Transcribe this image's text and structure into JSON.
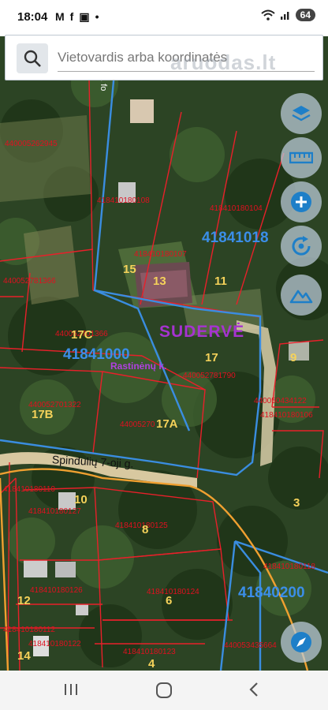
{
  "status_bar": {
    "time": "18:04",
    "left_icons": [
      "M",
      "f",
      "▣",
      "•"
    ],
    "battery": "64"
  },
  "search": {
    "placeholder": "Vietovardis arba koordinatės"
  },
  "watermark": "aruodas.lt",
  "map": {
    "road_label": "g. fo",
    "street_name": "Spindulių 7-oji g.",
    "village_name": "SUDERVĖ",
    "village_small": "Rastinėnų k.",
    "blue_ids": [
      "41841018",
      "41841000",
      "41840200"
    ],
    "parcel_ids": [
      "440005262945",
      "418410180108",
      "418410180104",
      "418410180107",
      "440052781366",
      "440052701366",
      "440052781790",
      "440052701322",
      "44005270",
      "440050434122",
      "418410180106",
      "418410180110",
      "418410180127",
      "418410180125",
      "418410180126",
      "418410180124",
      "418410180112",
      "418410180122",
      "418410180123",
      "418410180118",
      "440053435664"
    ],
    "plot_numbers": [
      "15",
      "13",
      "11",
      "17C",
      "17",
      "9",
      "17B",
      "17A",
      "10",
      "3",
      "8",
      "6",
      "12",
      "14",
      "4"
    ]
  },
  "colors": {
    "parcel_lines": "#e8202a",
    "cadastre_blue": "#3a8de0",
    "road_orange": "#f0a030",
    "plot_numbers": "#f5d25a",
    "village": "#a633d0"
  },
  "controls": [
    "layers-icon",
    "ruler-icon",
    "plus-icon",
    "locate-icon",
    "terrain-icon",
    "compass-icon"
  ],
  "nav": [
    "recent-apps",
    "home",
    "back"
  ]
}
